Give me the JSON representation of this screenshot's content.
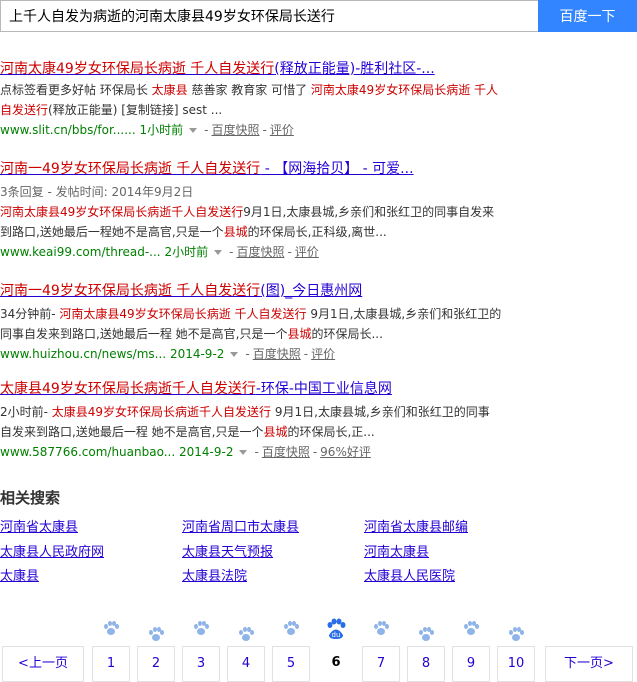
{
  "search": {
    "query": "上千人自发为病逝的河南太康县49岁女环保局长送行",
    "button_label": "百度一下"
  },
  "results": [
    {
      "title": [
        {
          "t": "河南太康49岁女环保局长病逝 千人自发送行",
          "em": true
        },
        {
          "t": "(释放正能量)-胜利社区-..."
        }
      ],
      "meta": "",
      "abstract_lines": [
        [
          {
            "t": "点标签看更多好帖 环保局长 "
          },
          {
            "t": "太康县",
            "em": true
          },
          {
            "t": " 慈善家 教育家 可惜了 "
          },
          {
            "t": "河南太康49岁女环保局长病逝 千人",
            "em": true
          }
        ],
        [
          {
            "t": "自发送行",
            "em": true
          },
          {
            "t": "(释放正能量) [复制链接] sest ..."
          }
        ]
      ],
      "url": "www.slit.cn/bbs/for......",
      "time": "1小时前",
      "snapshot": "百度快照",
      "extra": "评价"
    },
    {
      "title": [
        {
          "t": "河南一49岁女环保局长病逝 千人自发送行",
          "em": true
        },
        {
          "t": " - 【网海拾贝】 - 可爱..."
        }
      ],
      "meta": "3条回复 - 发帖时间: 2014年9月2日",
      "abstract_lines": [
        [
          {
            "t": "河南太康县49岁女环保局长病逝千人自发送行",
            "em": true
          },
          {
            "t": "9月1日,太康县城,乡亲们和张红卫的同事自发来"
          }
        ],
        [
          {
            "t": "到路口,送她最后一程她不是高官,只是一个"
          },
          {
            "t": "县城",
            "em": true
          },
          {
            "t": "的环保局长,正科级,离世..."
          }
        ]
      ],
      "url": "www.keai99.com/thread-...",
      "time": "2小时前",
      "snapshot": "百度快照",
      "extra": "评价"
    },
    {
      "title": [
        {
          "t": "河南一49岁女环保局长病逝 千人自发送行",
          "em": true
        },
        {
          "t": "(图)_今日惠州网"
        }
      ],
      "meta": "",
      "abstract_lines": [
        [
          {
            "t": "34分钟前- "
          },
          {
            "t": "河南太康县49岁女环保局长病逝 千人自发送行",
            "em": true
          },
          {
            "t": " 9月1日,太康县城,乡亲们和张红卫的"
          }
        ],
        [
          {
            "t": "同事自发来到路口,送她最后一程 她不是高官,只是一个"
          },
          {
            "t": "县城",
            "em": true
          },
          {
            "t": "的环保局长..."
          }
        ]
      ],
      "url": "www.huizhou.cn/news/ms...",
      "time": "2014-9-2",
      "snapshot": "百度快照",
      "extra": "评价"
    },
    {
      "title": [
        {
          "t": "太康县49岁女环保局长病逝千人自发送行",
          "em": true
        },
        {
          "t": "-环保-中国工业信息网"
        }
      ],
      "meta": "",
      "abstract_lines": [
        [
          {
            "t": "2小时前- "
          },
          {
            "t": "太康县49岁女环保局长病逝千人自发送行",
            "em": true
          },
          {
            "t": " 9月1日,太康县城,乡亲们和张红卫的同事"
          }
        ],
        [
          {
            "t": "自发来到路口,送她最后一程 她不是高官,只是一个"
          },
          {
            "t": "县城",
            "em": true
          },
          {
            "t": "的环保局长,正..."
          }
        ]
      ],
      "url": "www.587766.com/huanbao...",
      "time": "2014-9-2",
      "snapshot": "百度快照",
      "extra": "96%好评"
    }
  ],
  "related": {
    "heading": "相关搜索",
    "items": [
      "河南省太康县",
      "河南省周口市太康县",
      "河南省太康县邮编",
      "太康县人民政府网",
      "太康县天气预报",
      "河南太康县",
      "太康县",
      "太康县法院",
      "太康县人民医院"
    ]
  },
  "pagination": {
    "prev": "<上一页",
    "next": "下一页>",
    "pages": [
      "1",
      "2",
      "3",
      "4",
      "5",
      "6",
      "7",
      "8",
      "9",
      "10"
    ],
    "current": "6",
    "logo_text": "du"
  },
  "colors": {
    "link": "#2400d4",
    "highlight": "#cc0000",
    "url": "#008000",
    "button": "#3385ff",
    "paw": "#8fb4e8"
  }
}
